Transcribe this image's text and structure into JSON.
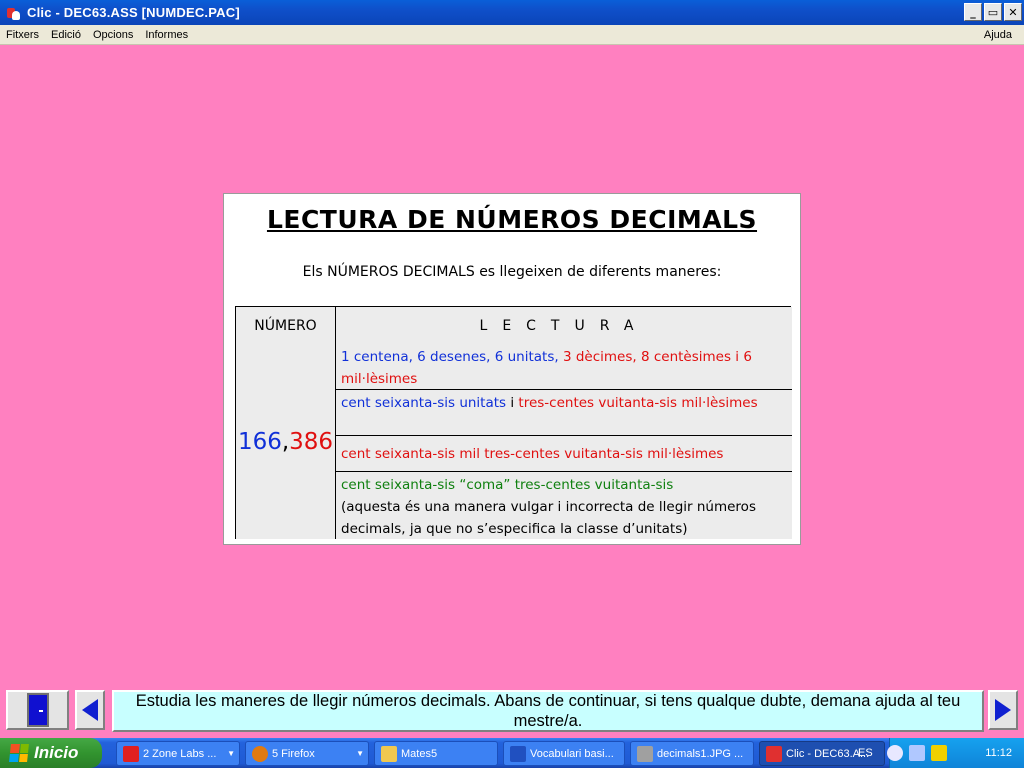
{
  "window": {
    "title": "Clic - DEC63.ASS [NUMDEC.PAC]",
    "minimize": "_",
    "restore": "▭",
    "close": "✕"
  },
  "menu": {
    "items": [
      "Fitxers",
      "Edició",
      "Opcions",
      "Informes"
    ],
    "help": "Ajuda"
  },
  "card": {
    "title": "LECTURA DE NÚMEROS DECIMALS",
    "subtitle": "Els NÚMEROS DECIMALS es llegeixen de diferents maneres:",
    "col_number": "NÚMERO",
    "col_reading": "LECTURA",
    "number_int": "166",
    "number_sep": ",",
    "number_dec": "386",
    "rows": [
      {
        "parts": [
          {
            "text": "1 centena, 6 desenes, 6 unitats, ",
            "color": "blue"
          },
          {
            "text": "3 dècimes, 8 centèsimes i 6 mil·lèsimes",
            "color": "red"
          }
        ]
      },
      {
        "parts": [
          {
            "text": "cent seixanta-sis unitats ",
            "color": "blue"
          },
          {
            "text": "i ",
            "color": "black"
          },
          {
            "text": "tres-centes vuitanta-sis mil·lèsimes",
            "color": "red"
          }
        ]
      },
      {
        "parts": [
          {
            "text": "cent seixanta-sis mil tres-centes vuitanta-sis mil·lèsimes",
            "color": "red"
          }
        ]
      },
      {
        "parts": [
          {
            "text": "cent seixanta-sis “coma” tres-centes vuitanta-sis",
            "color": "green"
          },
          {
            "text": "(aquesta és una manera vulgar i incorrecta de llegir números decimals, ja que no s’especifica la classe d’unitats)",
            "color": "black"
          }
        ]
      }
    ]
  },
  "message": "Estudia les maneres de llegir números decimals. Abans de continuar, si tens qualque dubte, demana ajuda al teu mestre/a.",
  "taskbar": {
    "start": "Inicio",
    "tasks": [
      {
        "label": "2 Zone Labs ...",
        "icon_color": "#e02020"
      },
      {
        "label": "5 Firefox",
        "icon_color": "#e07a10"
      },
      {
        "label": "Mates5",
        "icon_color": "#f0c850"
      },
      {
        "label": "Vocabulari basi...",
        "icon_color": "#2050c0"
      },
      {
        "label": "decimals1.JPG ...",
        "icon_color": "#a0a0a0"
      },
      {
        "label": "Clic - DEC63.A...",
        "icon_color": "#e03030"
      }
    ],
    "lang": "ES",
    "clock": "11:12"
  },
  "colors": {
    "background": "#ff80c0",
    "blue_text": "#1030d8",
    "red_text": "#e01010",
    "green_text": "#108010",
    "message_bg": "#c8ffff"
  }
}
